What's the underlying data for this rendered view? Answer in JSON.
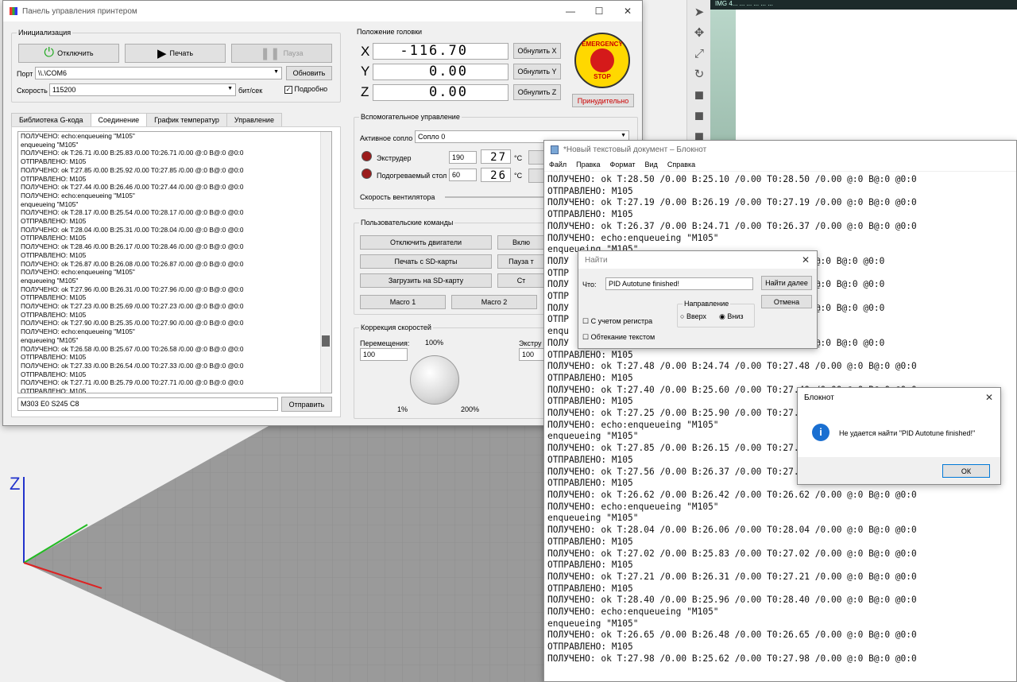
{
  "viewer": {
    "axis_z_label": "Z"
  },
  "toolbar_icons": [
    "cursor-icon",
    "move-icon",
    "scale-icon",
    "rotate-icon",
    "cube-icon",
    "cube-icon",
    "cube-icon"
  ],
  "top_strip": {
    "text": "IMG 4... ...  ...  ...  ...  ..."
  },
  "printer_panel": {
    "title": "Панель управления принтером",
    "init": {
      "title": "Инициализация",
      "disconnect": "Отключить",
      "print": "Печать",
      "pause": "Пауза",
      "port_label": "Порт",
      "port_value": "\\\\.\\COM6",
      "refresh": "Обновить",
      "speed_label": "Скорость",
      "speed_value": "115200",
      "speed_unit": "бит/сек",
      "verbose": "Подробно"
    },
    "tabs": [
      "Библиотека G-кода",
      "Соединение",
      "График температур",
      "Управление"
    ],
    "log": [
      "ПОЛУЧЕНО: echo:enqueueing \"M105\"",
      "enqueueing \"M105\"",
      "ПОЛУЧЕНО: ok T:26.71 /0.00 B:25.83 /0.00 T0:26.71 /0.00 @:0 B@:0 @0:0",
      "ОТПРАВЛЕНО: M105",
      "ПОЛУЧЕНО: ok T:27.85 /0.00 B:25.92 /0.00 T0:27.85 /0.00 @:0 B@:0 @0:0",
      "ОТПРАВЛЕНО: M105",
      "ПОЛУЧЕНО: ok T:27.44 /0.00 B:26.46 /0.00 T0:27.44 /0.00 @:0 B@:0 @0:0",
      "ПОЛУЧЕНО: echo:enqueueing \"M105\"",
      "enqueueing \"M105\"",
      "ПОЛУЧЕНО: ok T:28.17 /0.00 B:25.54 /0.00 T0:28.17 /0.00 @:0 B@:0 @0:0",
      "ОТПРАВЛЕНО: M105",
      "ПОЛУЧЕНО: ok T:28.04 /0.00 B:25.31 /0.00 T0:28.04 /0.00 @:0 B@:0 @0:0",
      "ОТПРАВЛЕНО: M105",
      "ПОЛУЧЕНО: ok T:28.46 /0.00 B:26.17 /0.00 T0:28.46 /0.00 @:0 B@:0 @0:0",
      "ОТПРАВЛЕНО: M105",
      "ПОЛУЧЕНО: ok T:26.87 /0.00 B:26.08 /0.00 T0:26.87 /0.00 @:0 B@:0 @0:0",
      "ПОЛУЧЕНО: echo:enqueueing \"M105\"",
      "enqueueing \"M105\"",
      "ПОЛУЧЕНО: ok T:27.96 /0.00 B:26.31 /0.00 T0:27.96 /0.00 @:0 B@:0 @0:0",
      "ОТПРАВЛЕНО: M105",
      "ПОЛУЧЕНО: ok T:27.23 /0.00 B:25.69 /0.00 T0:27.23 /0.00 @:0 B@:0 @0:0",
      "ОТПРАВЛЕНО: M105",
      "ПОЛУЧЕНО: ok T:27.90 /0.00 B:25.35 /0.00 T0:27.90 /0.00 @:0 B@:0 @0:0",
      "ПОЛУЧЕНО: echo:enqueueing \"M105\"",
      "enqueueing \"M105\"",
      "ПОЛУЧЕНО: ok T:26.58 /0.00 B:25.67 /0.00 T0:26.58 /0.00 @:0 B@:0 @0:0",
      "ОТПРАВЛЕНО: M105",
      "ПОЛУЧЕНО: ok T:27.33 /0.00 B:26.54 /0.00 T0:27.33 /0.00 @:0 B@:0 @0:0",
      "ОТПРАВЛЕНО: M105",
      "ПОЛУЧЕНО: ok T:27.71 /0.00 B:25.79 /0.00 T0:27.71 /0.00 @:0 B@:0 @0:0",
      "ОТПРАВЛЕНО: M105"
    ],
    "command_value": "M303 E0 S245 C8",
    "send": "Отправить",
    "head": {
      "title": "Положение головки",
      "x_label": "X",
      "x_value": "-116.70",
      "x_reset": "Обнулить X",
      "y_label": "Y",
      "y_value": "0.00",
      "y_reset": "Обнулить Y",
      "z_label": "Z",
      "z_value": "0.00",
      "z_reset": "Обнулить Z"
    },
    "emergency": {
      "top": "EMERGENCY",
      "bottom": "STOP",
      "force": "Принудительно"
    },
    "aux": {
      "title": "Вспомогательное управление",
      "nozzle_label": "Активное сопло",
      "nozzle_value": "Сопло 0",
      "extruder_label": "Экструдер",
      "extruder_target": "190",
      "extruder_temp": "27",
      "bed_label": "Подогреваемый стол",
      "bed_target": "60",
      "bed_temp": "26",
      "unit": "°C",
      "fan_label": "Скорость вентилятора"
    },
    "user_cmds": {
      "title": "Пользовательские команды",
      "b1": "Отключить двигатели",
      "b2": "Вклю",
      "b3": "Печать с SD-карты",
      "b4": "Пауза т",
      "b5": "Загрузить на SD-карту",
      "b6": "Ст",
      "b7": "Macro 1",
      "b8": "Macro 2"
    },
    "speed": {
      "title": "Коррекция скоростей",
      "move_label": "Перемещения:",
      "percent": "100%",
      "move_value": "100",
      "extrude_label": "Экстру",
      "extrude_value": "100",
      "min": "1%",
      "max": "200%"
    }
  },
  "notepad": {
    "title": "*Новый текстовый документ – Блокнот",
    "menu": [
      "Файл",
      "Правка",
      "Формат",
      "Вид",
      "Справка"
    ],
    "lines": [
      "ПОЛУЧЕНО: ok T:28.50 /0.00 B:25.10 /0.00 T0:28.50 /0.00 @:0 B@:0 @0:0",
      "ОТПРАВЛЕНО: M105",
      "ПОЛУЧЕНО: ok T:27.19 /0.00 B:26.19 /0.00 T0:27.19 /0.00 @:0 B@:0 @0:0",
      "ОТПРАВЛЕНО: M105",
      "ПОЛУЧЕНО: ok T:26.37 /0.00 B:24.71 /0.00 T0:26.37 /0.00 @:0 B@:0 @0:0",
      "ПОЛУЧЕНО: echo:enqueueing \"M105\"",
      "enqueueing \"M105\"",
      "ПОЛУ                                          .00 @:0 B@:0 @0:0",
      "ОТПР",
      "ПОЛУ                                          .00 @:0 B@:0 @0:0",
      "ОТПР",
      "ПОЛУ                                          .00 @:0 B@:0 @0:0",
      "ОТПР",
      "enqu",
      "ПОЛУ                                          .00 @:0 B@:0 @0:0",
      "ОТПРАВЛЕНО: M105",
      "ПОЛУЧЕНО: ok T:27.48 /0.00 B:24.74 /0.00 T0:27.48 /0.00 @:0 B@:0 @0:0",
      "ОТПРАВЛЕНО: M105",
      "ПОЛУЧЕНО: ok T:27.40 /0.00 B:25.60 /0.00 T0:27.40 /0.00 @:0 B@:0 @0:0",
      "ОТПРАВЛЕНО: M105",
      "ПОЛУЧЕНО: ok T:27.25 /0.00 B:25.90 /0.00 T0:27.25",
      "ПОЛУЧЕНО: echo:enqueueing \"M105\"",
      "enqueueing \"M105\"",
      "ПОЛУЧЕНО: ok T:27.85 /0.00 B:26.15 /0.00 T0:27.85",
      "ОТПРАВЛЕНО: M105",
      "ПОЛУЧЕНО: ok T:27.56 /0.00 B:26.37 /0.00 T0:27.56",
      "ОТПРАВЛЕНО: M105",
      "ПОЛУЧЕНО: ok T:26.62 /0.00 B:26.42 /0.00 T0:26.62 /0.00 @:0 B@:0 @0:0",
      "ПОЛУЧЕНО: echo:enqueueing \"M105\"",
      "enqueueing \"M105\"",
      "ПОЛУЧЕНО: ok T:28.04 /0.00 B:26.06 /0.00 T0:28.04 /0.00 @:0 B@:0 @0:0",
      "ОТПРАВЛЕНО: M105",
      "ПОЛУЧЕНО: ok T:27.02 /0.00 B:25.83 /0.00 T0:27.02 /0.00 @:0 B@:0 @0:0",
      "ОТПРАВЛЕНО: M105",
      "ПОЛУЧЕНО: ok T:27.21 /0.00 B:26.31 /0.00 T0:27.21 /0.00 @:0 B@:0 @0:0",
      "ОТПРАВЛЕНО: M105",
      "ПОЛУЧЕНО: ok T:28.40 /0.00 B:25.96 /0.00 T0:28.40 /0.00 @:0 B@:0 @0:0",
      "ПОЛУЧЕНО: echo:enqueueing \"M105\"",
      "enqueueing \"M105\"",
      "ПОЛУЧЕНО: ok T:26.65 /0.00 B:26.48 /0.00 T0:26.65 /0.00 @:0 B@:0 @0:0",
      "ОТПРАВЛЕНО: M105",
      "ПОЛУЧЕНО: ok T:27.98 /0.00 B:25.62 /0.00 T0:27.98 /0.00 @:0 B@:0 @0:0"
    ]
  },
  "find": {
    "title": "Найти",
    "what_label": "Что:",
    "what_value": "PID Autotune finished!",
    "find_next": "Найти далее",
    "cancel": "Отмена",
    "direction": "Направление",
    "up": "Вверх",
    "down": "Вниз",
    "match_case": "С учетом регистра",
    "wrap": "Обтекание текстом"
  },
  "msgbox": {
    "title": "Блокнот",
    "text": "Не удается найти \"PID Autotune finished!\"",
    "ok": "ОК"
  }
}
